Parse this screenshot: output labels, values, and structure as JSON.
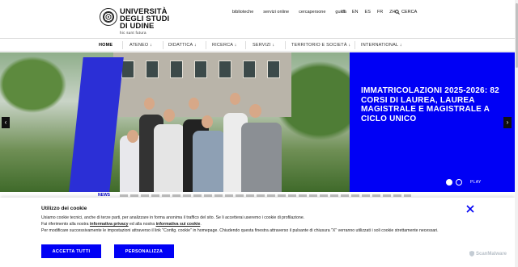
{
  "brand": {
    "line1": "UNIVERSITÀ",
    "line2": "DEGLI STUDI",
    "line3": "DI UDINE",
    "tagline": "hic sunt futura"
  },
  "header": {
    "links": [
      "biblioteche",
      "servizi online",
      "cercapersone",
      "guida"
    ],
    "languages": [
      "IT",
      "EN",
      "ES",
      "FR",
      "ZH"
    ],
    "search_label": "CERCA"
  },
  "nav": {
    "items": [
      "HOME",
      "ATENEO ↓",
      "DIDATTICA ↓",
      "RICERCA ↓",
      "SERVIZI ↓",
      "TERRITORIO E SOCIETÀ ↓",
      "INTERNATIONAL ↓"
    ],
    "active": "HOME"
  },
  "hero": {
    "title": "IMMATRICOLAZIONI 2025-2026: 82 CORSI DI LAUREA, LAUREA MAGISTRALE E MAGISTRALE A CICLO UNICO",
    "prev_label": "‹",
    "next_label": "›",
    "play_label": "PLAY",
    "slides": 2,
    "current_slide": 1
  },
  "strip": {
    "label": "NEWS"
  },
  "cookie": {
    "title": "Utilizzo dei cookie",
    "line1": "Usiamo cookie tecnici, anche di terze parti, per analizzare in forma anonima il traffico del sito. Se li accetterai useremo i cookie di profilazione.",
    "line2_pre": "Fai riferimento alla nostra ",
    "privacy_link": "informativa privacy",
    "line2_mid": " ed alla nostra ",
    "cookie_link": "informativa sui cookie",
    "line2_post": ".",
    "line3": "Per modificare successivamente le impostazioni attraverso il link \"Config. cookie\" in homepage. Chiudendo questa finestra attraverso il pulsante di chiusura \"X\" verranno utilizzati i soli cookie strettamente necessari.",
    "accept_label": "ACCETTA TUTTI",
    "customize_label": "PERSONALIZZA"
  },
  "watermark": "ScanMalware",
  "colors": {
    "accent": "#0000f5",
    "text": "#111111"
  }
}
